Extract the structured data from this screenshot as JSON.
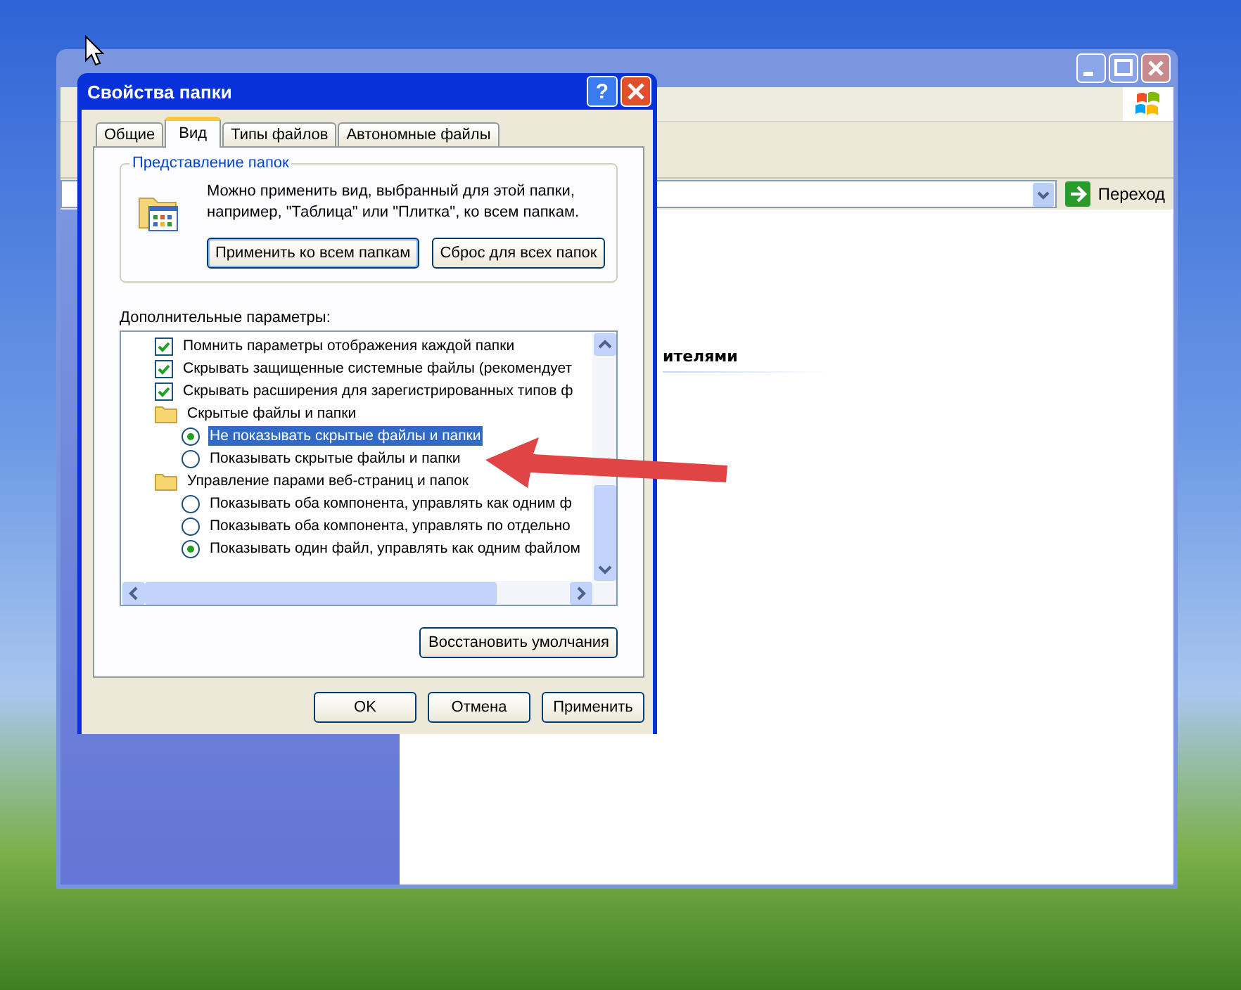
{
  "explorer": {
    "go_button": "Переход",
    "section_heading": "ителями"
  },
  "dialog": {
    "title": "Свойства папки",
    "help_button": "?",
    "tabs": [
      {
        "label": "Общие",
        "selected": false
      },
      {
        "label": "Вид",
        "selected": true
      },
      {
        "label": "Типы файлов",
        "selected": false
      },
      {
        "label": "Автономные файлы",
        "selected": false
      }
    ],
    "folder_views": {
      "legend": "Представление папок",
      "description": "Можно применить вид, выбранный для этой папки, например, \"Таблица\" или \"Плитка\", ко всем папкам.",
      "buttons": [
        "Применить ко всем папкам",
        "Сброс для всех папок"
      ]
    },
    "advanced": {
      "label": "Дополнительные параметры:",
      "options": [
        {
          "kind": "checkbox",
          "label": "Помнить параметры отображения каждой папки",
          "checked": true
        },
        {
          "kind": "checkbox",
          "label": "Скрывать защищенные системные файлы (рекомендует",
          "checked": true
        },
        {
          "kind": "checkbox",
          "label": "Скрывать расширения для зарегистрированных типов ф",
          "checked": true
        },
        {
          "kind": "folder",
          "label": "Скрытые файлы и папки",
          "children": [
            {
              "kind": "radio",
              "label": "Не показывать скрытые файлы и папки",
              "checked": true,
              "selected": true
            },
            {
              "kind": "radio",
              "label": "Показывать скрытые файлы и папки",
              "checked": false,
              "selected": false
            }
          ]
        },
        {
          "kind": "folder",
          "label": "Управление парами веб-страниц и папок",
          "children": [
            {
              "kind": "radio",
              "label": "Показывать оба компонента, управлять как одним ф",
              "checked": false,
              "selected": false
            },
            {
              "kind": "radio",
              "label": "Показывать оба компонента, управлять по отдельно",
              "checked": false,
              "selected": false
            },
            {
              "kind": "radio",
              "label": "Показывать один файл, управлять как одним файлом",
              "checked": true,
              "selected": false
            }
          ]
        }
      ]
    },
    "restore_button": "Восстановить умолчания",
    "buttons": [
      "OK",
      "Отмена",
      "Применить"
    ]
  }
}
